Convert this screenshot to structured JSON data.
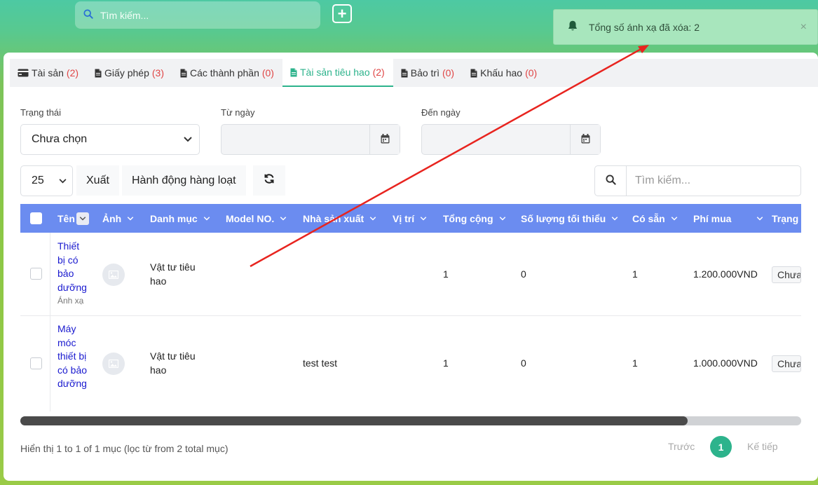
{
  "topbar": {
    "search_placeholder": "Tìm kiếm..."
  },
  "toast": {
    "message": "Tổng số ánh xạ đã xóa: 2",
    "close": "×"
  },
  "tabs": [
    {
      "label": "Tài sản",
      "count": "(2)",
      "icon": "credit-card-icon"
    },
    {
      "label": "Giấy phép",
      "count": "(3)",
      "icon": "file-icon"
    },
    {
      "label": "Các thành phần",
      "count": "(0)",
      "icon": "file-icon"
    },
    {
      "label": "Tài sản tiêu hao",
      "count": "(2)",
      "icon": "file-icon",
      "active": true
    },
    {
      "label": "Bảo trì",
      "count": "(0)",
      "icon": "file-icon"
    },
    {
      "label": "Khấu hao",
      "count": "(0)",
      "icon": "file-icon"
    }
  ],
  "filters": {
    "status_label": "Trạng thái",
    "status_value": "Chưa chọn",
    "from_label": "Từ ngày",
    "to_label": "Đến ngày"
  },
  "toolbar": {
    "page_size": "25",
    "export": "Xuất",
    "bulk": "Hành động hàng loạt",
    "search_placeholder": "Tìm kiếm..."
  },
  "table": {
    "columns": [
      "Tên",
      "Ảnh",
      "Danh mục",
      "Model NO.",
      "Nhà sản xuất",
      "Vị trí",
      "Tổng cộng",
      "Số lượng tối thiểu",
      "Có sẵn",
      "Phí mua",
      "Trạng"
    ],
    "rows": [
      {
        "name_lines": [
          "Thiết",
          "bị có",
          "bảo",
          "dưỡng"
        ],
        "sub": "Ánh xạ",
        "category_lines": [
          "Vật tư tiêu",
          "hao"
        ],
        "manufacturer": "",
        "total": "1",
        "min_qty": "0",
        "available": "1",
        "price": "1.200.000VND",
        "status": "Chưa"
      },
      {
        "name_lines": [
          "Máy",
          "móc",
          "thiết bị",
          "có bảo",
          "dưỡng"
        ],
        "sub": "",
        "category_lines": [
          "Vật tư tiêu",
          "hao"
        ],
        "manufacturer": "test test",
        "total": "1",
        "min_qty": "0",
        "available": "1",
        "price": "1.000.000VND",
        "status": "Chưa"
      }
    ]
  },
  "footer": {
    "info": "Hiển thị 1 to 1 of 1 mục (lọc từ from 2 total mục)",
    "prev": "Trước",
    "current": "1",
    "next": "Kế tiếp"
  },
  "colors": {
    "accent": "#2db38c",
    "header_blue": "#6b8cf0",
    "count_red": "#e04545",
    "toast_bg": "#a8e6bd",
    "annotation_red": "#e8241f"
  }
}
